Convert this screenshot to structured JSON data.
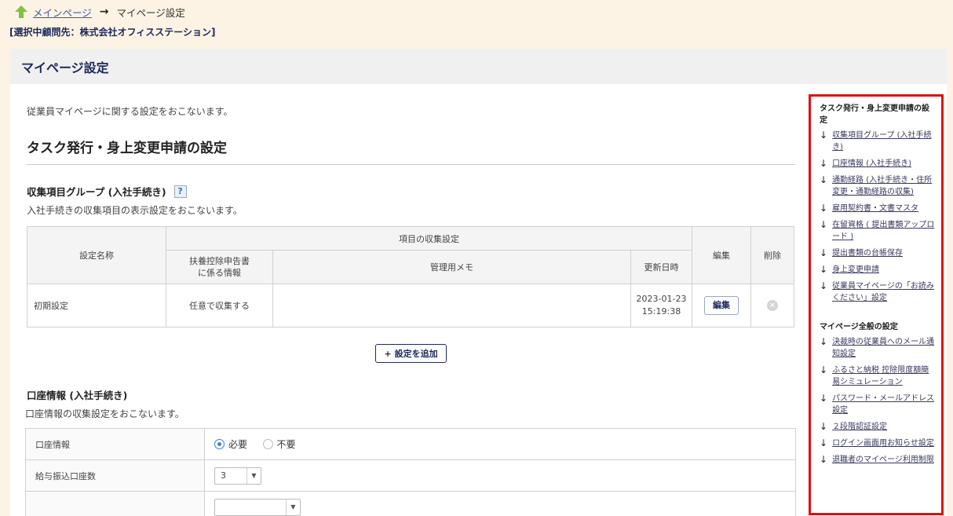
{
  "breadcrumb": {
    "home_label": "メインページ",
    "arrow": "→",
    "current": "マイページ設定"
  },
  "company_label": "[選択中顧問先：株式会社オフィスステーション]",
  "page_title": "マイページ設定",
  "intro": "従業員マイページに関する設定をおこないます。",
  "section_title": "タスク発行・身上変更申請の設定",
  "group": {
    "title": "収集項目グループ (入社手続き)",
    "help": "?",
    "desc": "入社手続きの収集項目の表示設定をおこないます。",
    "headers": {
      "name": "設定名称",
      "collect": "項目の収集設定",
      "dependent": "扶養控除申告書\nに係る情報",
      "memo": "管理用メモ",
      "updated": "更新日時",
      "edit": "編集",
      "delete": "削除"
    },
    "rows": [
      {
        "name": "初期設定",
        "dependent": "任意で収集する",
        "memo": "",
        "updated_date": "2023-01-23",
        "updated_time": "15:19:38",
        "edit_label": "編集"
      }
    ],
    "add_label": "設定を追加",
    "add_icon": "+"
  },
  "account": {
    "title": "口座情報 (入社手続き)",
    "desc": "口座情報の収集設定をおこないます。",
    "rows": [
      {
        "label": "口座情報",
        "opt_required": "必要",
        "opt_unneeded": "不要"
      },
      {
        "label": "給与振込口座数",
        "value": "3"
      }
    ]
  },
  "sidebar": {
    "head1": "タスク発行・身上変更申請の設定",
    "links1": [
      "収集項目グループ (入社手続き)",
      "口座情報 (入社手続き)",
      "通勤経路 (入社手続き・住所変更・通勤経路の収集)",
      "雇用契約書・文書マスタ",
      "在留資格 ( 提出書類アップロード )",
      "提出書類の台帳保存",
      "身上変更申請",
      "従業員マイページの「お読みください」設定"
    ],
    "head2": "マイページ全般の設定",
    "links2": [
      "決裁時の従業員へのメール通知設定",
      "ふるさと納税 控除限度額簡易シミュレーション",
      "パスワード・メールアドレス設定",
      "２段階認証設定",
      "ログイン画面用お知らせ設定",
      "退職者のマイページ利用制限"
    ],
    "arrow": "↓"
  },
  "colors": {
    "accent": "#1d2a5c",
    "highlight_border": "#e01010",
    "page_bg": "#fdf3e4"
  }
}
